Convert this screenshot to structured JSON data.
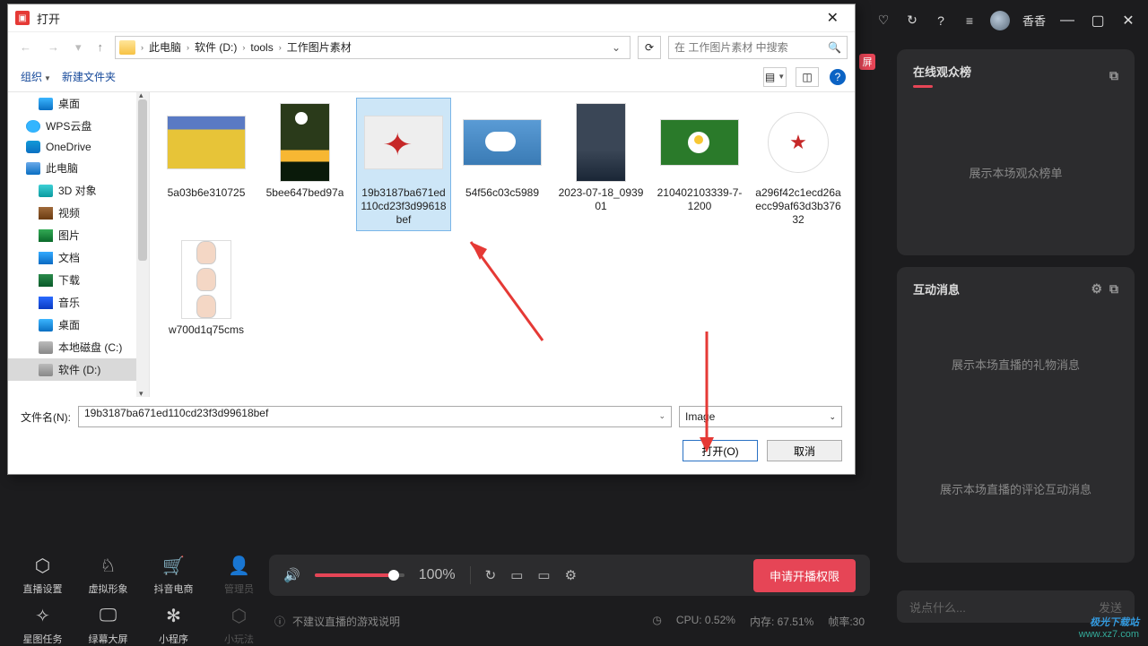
{
  "header": {
    "username": "香香"
  },
  "badge_screen": "屏",
  "panel1": {
    "title": "在线观众榜",
    "body": "展示本场观众榜单"
  },
  "panel2": {
    "title": "互动消息",
    "body1": "展示本场直播的礼物消息",
    "body2": "展示本场直播的评论互动消息"
  },
  "chat": {
    "placeholder": "说点什么...",
    "send": "发送"
  },
  "tools_top": [
    {
      "label": "直播设置",
      "icon": "⬡"
    },
    {
      "label": "虚拟形象",
      "icon": "♘"
    },
    {
      "label": "抖音电商",
      "icon": "🛒"
    },
    {
      "label": "管理员",
      "icon": "👤",
      "disabled": true
    }
  ],
  "tools_bottom": [
    {
      "label": "星图任务",
      "icon": "✧"
    },
    {
      "label": "绿幕大屏",
      "icon": "🖵"
    },
    {
      "label": "小程序",
      "icon": "✻"
    },
    {
      "label": "小玩法",
      "icon": "⬡",
      "disabled": true
    }
  ],
  "ctrl": {
    "volume": "100%",
    "apply": "申请开播权限"
  },
  "status": {
    "left_text": "不建议直播的游戏说明",
    "cpu": "CPU: 0.52%",
    "mem": "内存: 67.51%",
    "fps": "帧率:30"
  },
  "watermark": {
    "l1": "极光下载站",
    "l2": "www.xz7.com"
  },
  "dialog": {
    "title": "打开",
    "path": [
      "此电脑",
      "软件 (D:)",
      "tools",
      "工作图片素材"
    ],
    "search_placeholder": "在 工作图片素材 中搜索",
    "toolbar": {
      "organize": "组织",
      "new_folder": "新建文件夹"
    },
    "tree": [
      {
        "label": "桌面",
        "ic": "ic-monitor",
        "ind": true
      },
      {
        "label": "WPS云盘",
        "ic": "ic-cloud"
      },
      {
        "label": "OneDrive",
        "ic": "ic-one"
      },
      {
        "label": "此电脑",
        "ic": "ic-pc"
      },
      {
        "label": "3D 对象",
        "ic": "ic-3d",
        "ind": true
      },
      {
        "label": "视频",
        "ic": "ic-vid",
        "ind": true
      },
      {
        "label": "图片",
        "ic": "ic-img",
        "ind": true
      },
      {
        "label": "文档",
        "ic": "ic-doc",
        "ind": true
      },
      {
        "label": "下载",
        "ic": "ic-dl",
        "ind": true
      },
      {
        "label": "音乐",
        "ic": "ic-music",
        "ind": true
      },
      {
        "label": "桌面",
        "ic": "ic-monitor",
        "ind": true
      },
      {
        "label": "本地磁盘 (C:)",
        "ic": "ic-disk",
        "ind": true
      },
      {
        "label": "软件 (D:)",
        "ic": "ic-disk",
        "ind": true,
        "sel": true
      }
    ],
    "files": [
      {
        "name": "5a03b6e310725",
        "thumb": "t-yellow"
      },
      {
        "name": "5bee647bed97a",
        "thumb": "t-sunset"
      },
      {
        "name": "19b3187ba671ed110cd23f3d99618bef",
        "thumb": "t-maple",
        "sel": true
      },
      {
        "name": "54f56c03c5989",
        "thumb": "t-cloud"
      },
      {
        "name": "2023-07-18_093901",
        "thumb": "t-night"
      },
      {
        "name": "210402103339-7-1200",
        "thumb": "t-daisy"
      },
      {
        "name": "a296f42c1ecd26aecc99af63d3b37632",
        "thumb": "t-stamp"
      },
      {
        "name": "w700d1q75cms",
        "thumb": "t-faces"
      }
    ],
    "filename_label": "文件名(N):",
    "filename_value": "19b3187ba671ed110cd23f3d99618bef",
    "filetype": "Image",
    "open": "打开(O)",
    "cancel": "取消"
  }
}
